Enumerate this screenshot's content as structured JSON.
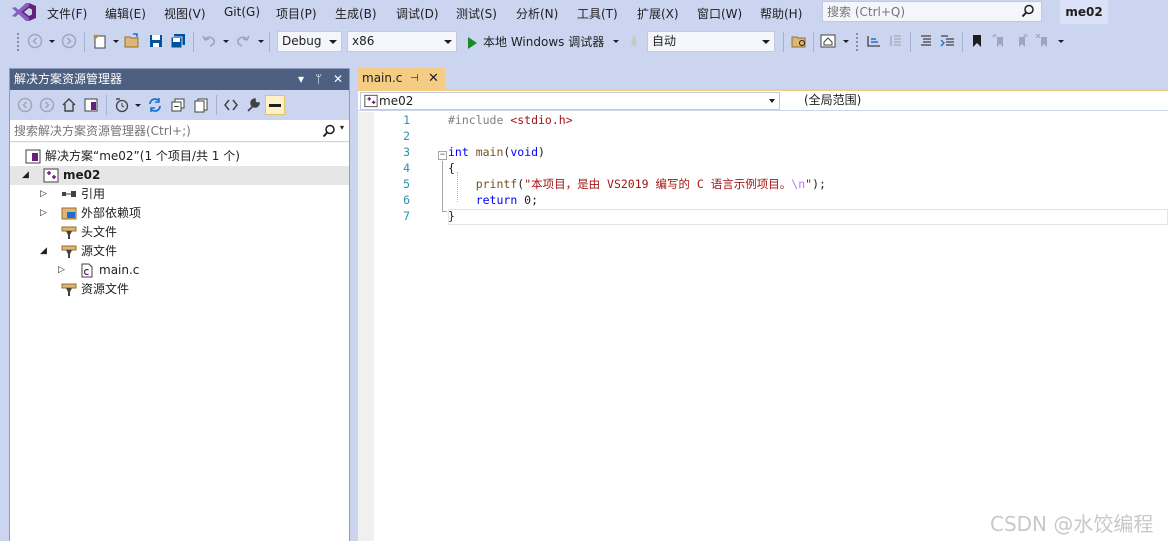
{
  "menubar": {
    "items": [
      "文件(F)",
      "编辑(E)",
      "视图(V)",
      "Git(G)",
      "项目(P)",
      "生成(B)",
      "调试(D)",
      "测试(S)",
      "分析(N)",
      "工具(T)",
      "扩展(X)",
      "窗口(W)",
      "帮助(H)"
    ],
    "search_placeholder": "搜索 (Ctrl+Q)",
    "solution_name": "me02"
  },
  "toolbar": {
    "configuration": "Debug",
    "platform": "x86",
    "run_label": "本地 Windows 调试器",
    "launch_mode": "自动"
  },
  "solution_explorer": {
    "title": "解决方案资源管理器",
    "search_placeholder": "搜索解决方案资源管理器(Ctrl+;)",
    "tree": [
      {
        "label": "解决方案“me02”(1 个项目/共 1 个)",
        "icon": "solution-icon",
        "twisty": ""
      },
      {
        "label": "me02",
        "icon": "project-icon",
        "twisty": "expanded",
        "bold": true
      },
      {
        "label": "引用",
        "icon": "references-icon",
        "twisty": "collapsed"
      },
      {
        "label": "外部依赖项",
        "icon": "external-deps-icon",
        "twisty": "collapsed"
      },
      {
        "label": "头文件",
        "icon": "filter-folder-icon",
        "twisty": ""
      },
      {
        "label": "源文件",
        "icon": "filter-folder-icon",
        "twisty": "expanded"
      },
      {
        "label": "main.c",
        "icon": "c-file-icon",
        "twisty": "collapsed"
      },
      {
        "label": "资源文件",
        "icon": "filter-folder-icon",
        "twisty": ""
      }
    ]
  },
  "editor": {
    "tab_label": "main.c",
    "nav_project": "me02",
    "nav_scope": "(全局范围)",
    "lines": [
      {
        "n": "1",
        "parts": [
          [
            "pp",
            "#include "
          ],
          [
            "str",
            "<stdio.h>"
          ]
        ]
      },
      {
        "n": "2",
        "parts": []
      },
      {
        "n": "3",
        "parts": [
          [
            "kw",
            "int"
          ],
          [
            "fn",
            " main"
          ],
          [
            "txt",
            "("
          ],
          [
            "kw",
            "void"
          ],
          [
            "txt",
            ")"
          ]
        ]
      },
      {
        "n": "4",
        "parts": [
          [
            "txt",
            "{"
          ]
        ]
      },
      {
        "n": "5",
        "parts": [
          [
            "txt",
            "    "
          ],
          [
            "fn",
            "printf"
          ],
          [
            "txt",
            "("
          ],
          [
            "str",
            "\"本项目，是由 VS2019 编写的 C 语言示例项目。"
          ],
          [
            "esc",
            "\\n"
          ],
          [
            "str",
            "\""
          ],
          [
            "txt",
            ");"
          ]
        ]
      },
      {
        "n": "6",
        "parts": [
          [
            "txt",
            "    "
          ],
          [
            "kw",
            "return"
          ],
          [
            "txt",
            " 0;"
          ]
        ]
      },
      {
        "n": "7",
        "parts": [
          [
            "txt",
            "}"
          ]
        ]
      }
    ]
  },
  "watermark": "CSDN @水饺编程"
}
